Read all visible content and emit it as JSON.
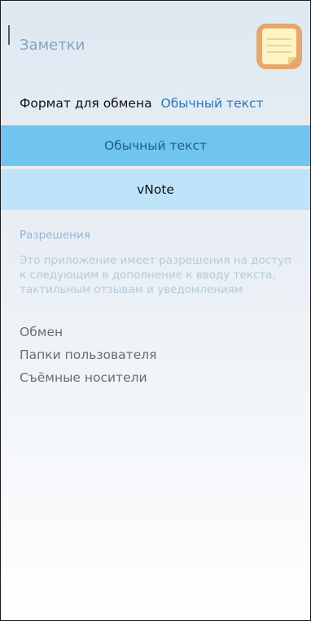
{
  "app": {
    "title": "Заметки",
    "icon": "notes-app-icon",
    "accent_color": "#72c4f0"
  },
  "share_format": {
    "label": "Формат для обмена",
    "current_value": "Обычный текст",
    "options": [
      {
        "label": "Обычный текст",
        "selected": true
      },
      {
        "label": "vNote",
        "selected": false
      }
    ]
  },
  "permissions": {
    "header": "Разрешения",
    "description": "Это приложение имеет разрешения на доступ к следующим в дополнение к вводу текста, тактильным отзывам и уведомлениям",
    "items": [
      "Обмен",
      "Папки пользователя",
      "Съёмные носители"
    ]
  }
}
